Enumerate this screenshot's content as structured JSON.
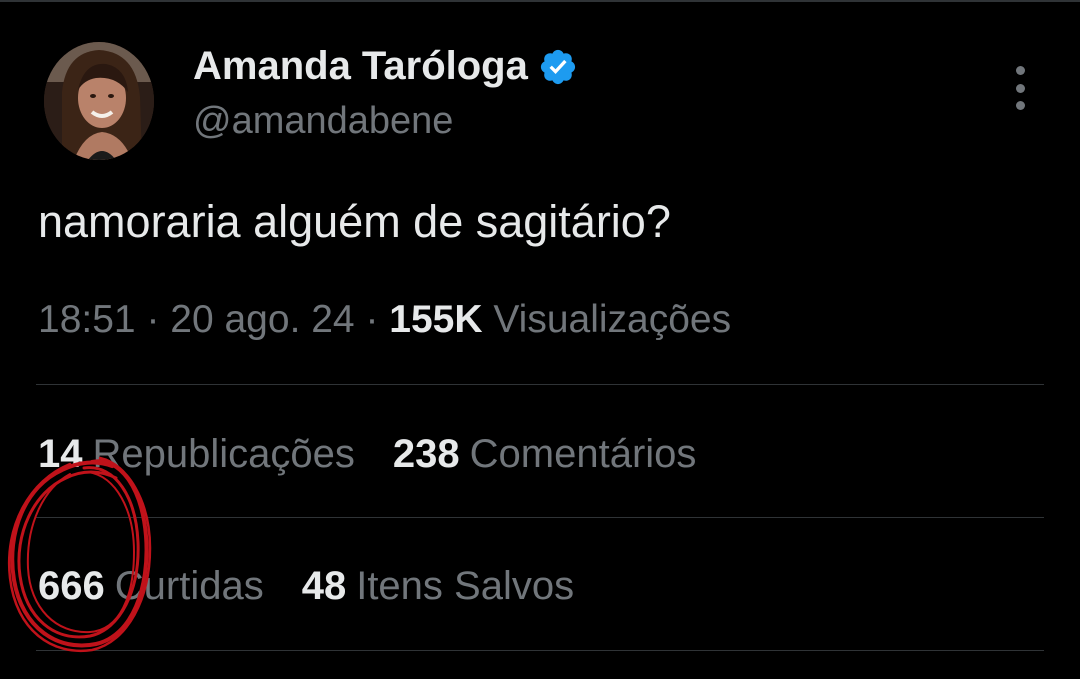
{
  "colors": {
    "background": "#000000",
    "primary_text": "#e7e9ea",
    "secondary_text": "#71767b",
    "divider": "#2f3336",
    "verified_badge": "#1d9bf0",
    "annotation_circle": "#c0121a"
  },
  "author": {
    "display_name": "Amanda Taróloga",
    "handle": "@amandabene",
    "verified_icon": "verified-badge-icon",
    "avatar_icon": "profile-photo"
  },
  "menu_icon": "more-options-icon",
  "tweet": {
    "text": "namoraria alguém de sagitário?"
  },
  "meta": {
    "time": "18:51",
    "separator": " · ",
    "date": "20 ago. 24",
    "views_count": "155K",
    "views_label": "Visualizações"
  },
  "stats": {
    "reposts_count": "14",
    "reposts_label": "Republicações",
    "comments_count": "238",
    "comments_label": "Comentários",
    "likes_count": "666",
    "likes_label": "Curtidas",
    "saves_count": "48",
    "saves_label": "Itens Salvos"
  }
}
